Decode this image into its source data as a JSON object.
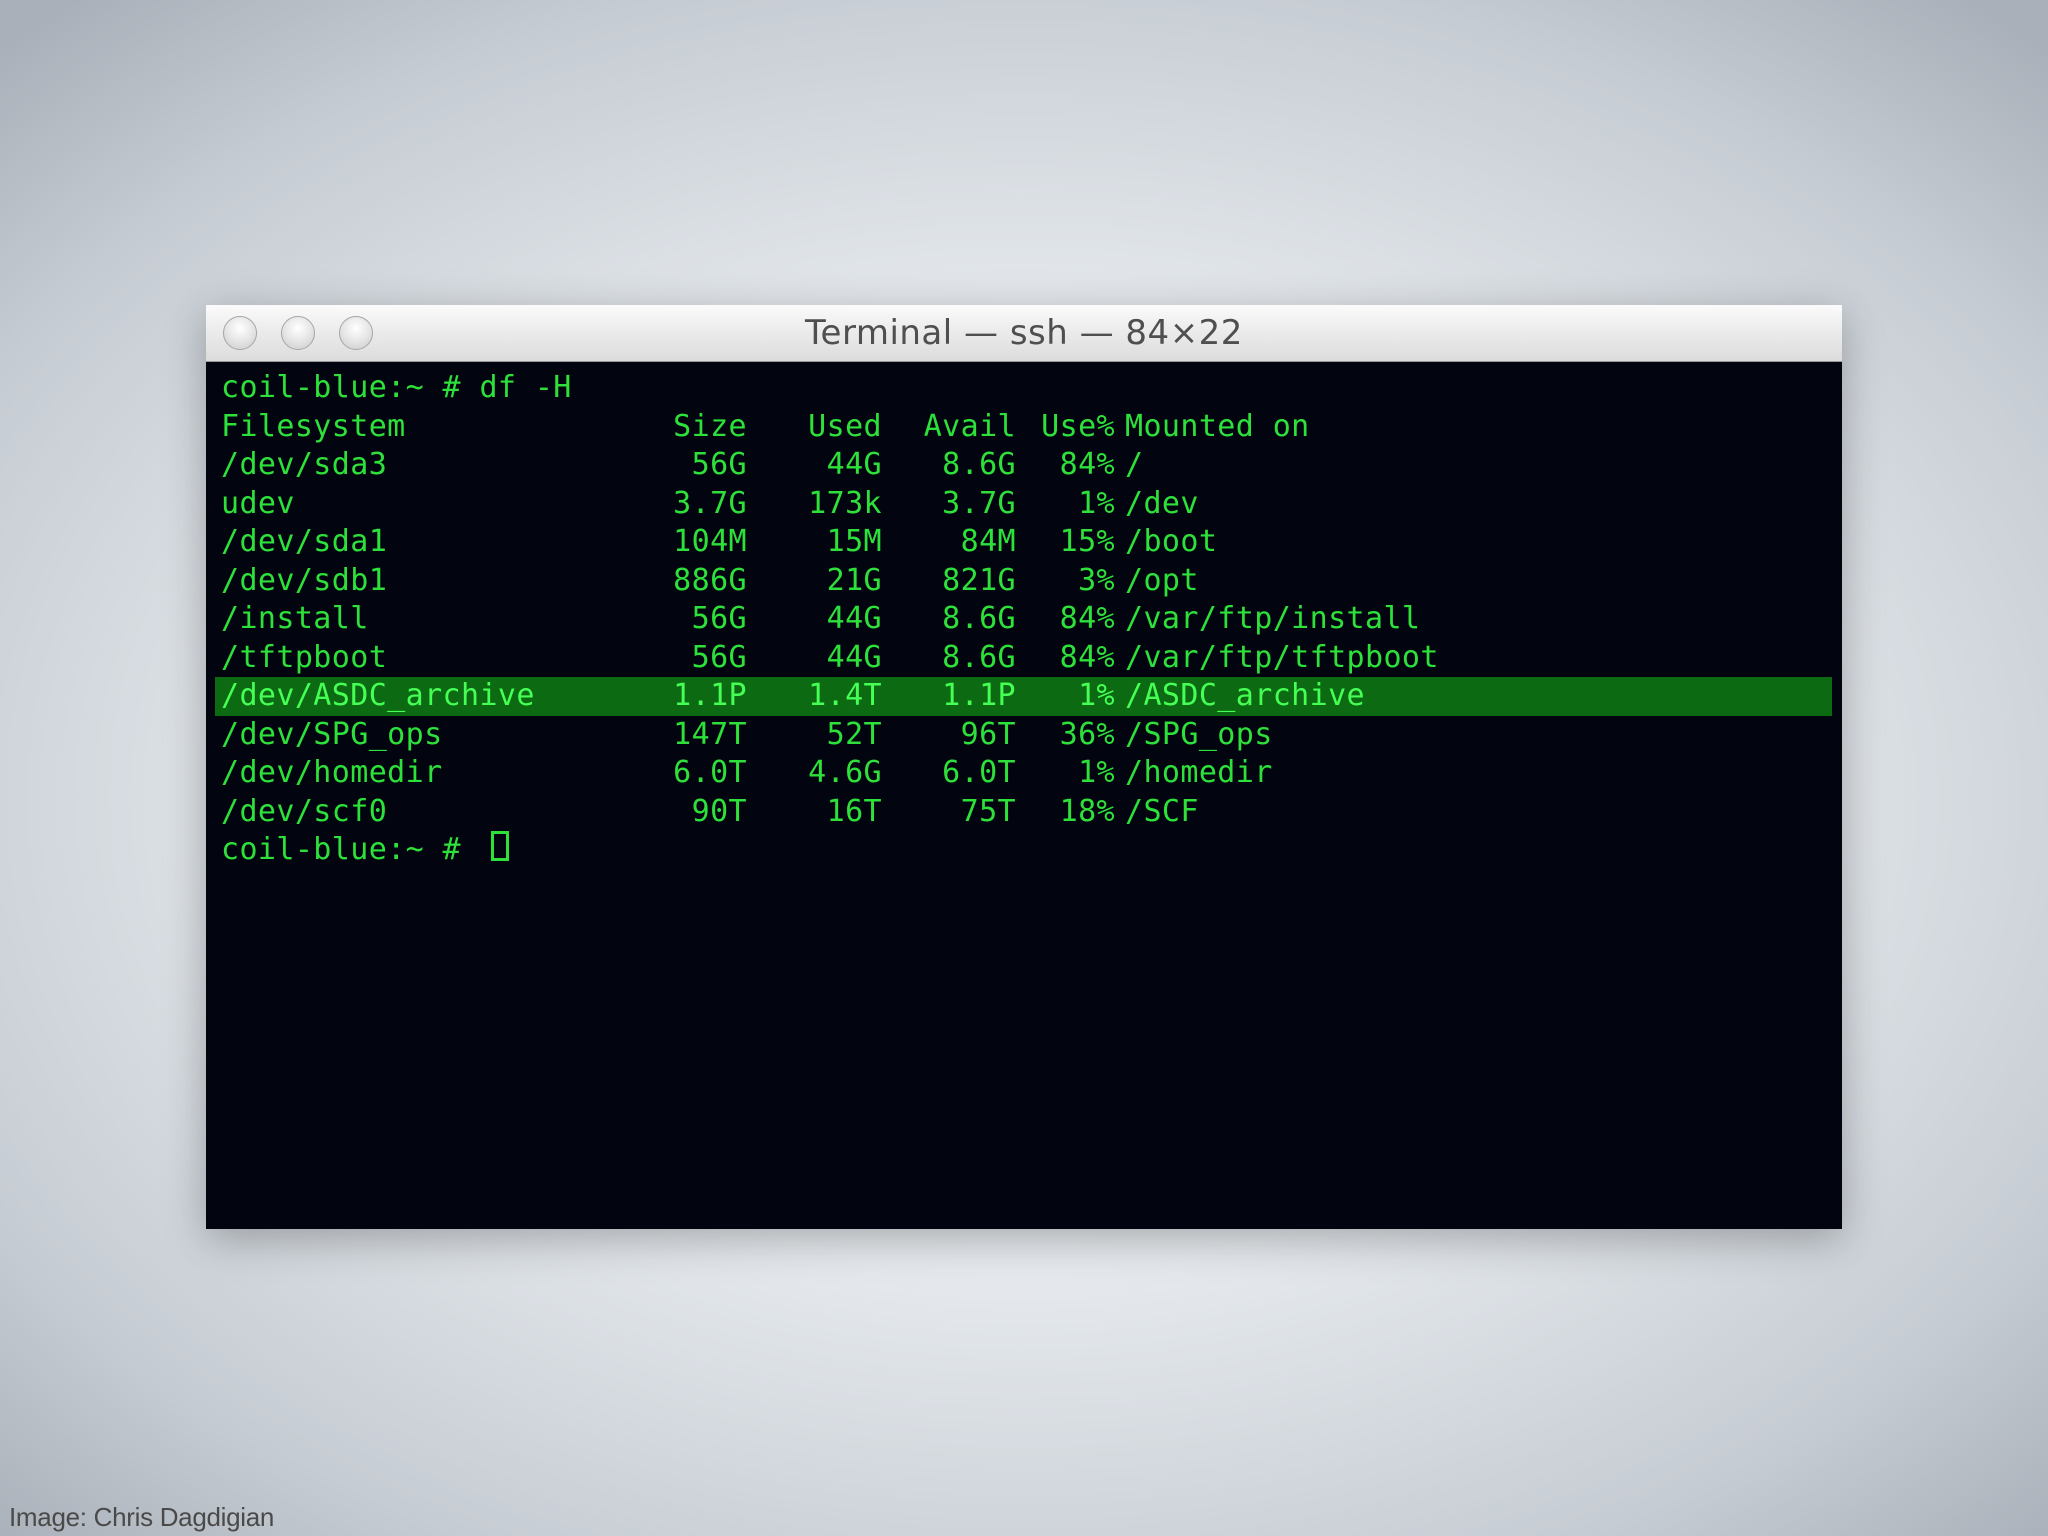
{
  "window": {
    "title": "Terminal — ssh — 84×22"
  },
  "terminal": {
    "command_line": "coil-blue:~ # df -H",
    "headers": {
      "filesystem": "Filesystem",
      "size": "Size",
      "used": "Used",
      "avail": "Avail",
      "use_pct": "Use%",
      "mounted_on": "Mounted on"
    },
    "rows": [
      {
        "fs": "/dev/sda3",
        "size": "56G",
        "used": "44G",
        "avail": "8.6G",
        "use": "84%",
        "mount": "/"
      },
      {
        "fs": "udev",
        "size": "3.7G",
        "used": "173k",
        "avail": "3.7G",
        "use": "1%",
        "mount": "/dev"
      },
      {
        "fs": "/dev/sda1",
        "size": "104M",
        "used": "15M",
        "avail": "84M",
        "use": "15%",
        "mount": "/boot"
      },
      {
        "fs": "/dev/sdb1",
        "size": "886G",
        "used": "21G",
        "avail": "821G",
        "use": "3%",
        "mount": "/opt"
      },
      {
        "fs": "/install",
        "size": "56G",
        "used": "44G",
        "avail": "8.6G",
        "use": "84%",
        "mount": "/var/ftp/install"
      },
      {
        "fs": "/tftpboot",
        "size": "56G",
        "used": "44G",
        "avail": "8.6G",
        "use": "84%",
        "mount": "/var/ftp/tftpboot"
      },
      {
        "fs": "/dev/ASDC_archive",
        "size": "1.1P",
        "used": "1.4T",
        "avail": "1.1P",
        "use": "1%",
        "mount": "/ASDC_archive"
      },
      {
        "fs": "/dev/SPG_ops",
        "size": "147T",
        "used": "52T",
        "avail": "96T",
        "use": "36%",
        "mount": "/SPG_ops"
      },
      {
        "fs": "/dev/homedir",
        "size": "6.0T",
        "used": "4.6G",
        "avail": "6.0T",
        "use": "1%",
        "mount": "/homedir"
      },
      {
        "fs": "/dev/scf0",
        "size": "90T",
        "used": "16T",
        "avail": "75T",
        "use": "18%",
        "mount": "/SCF"
      }
    ],
    "prompt": "coil-blue:~ # "
  },
  "credit": "Image: Chris Dagdigian",
  "colors": {
    "terminal_bg": "#02050f",
    "terminal_text": "#2de13a",
    "highlight_bg": "#0b6a12"
  }
}
